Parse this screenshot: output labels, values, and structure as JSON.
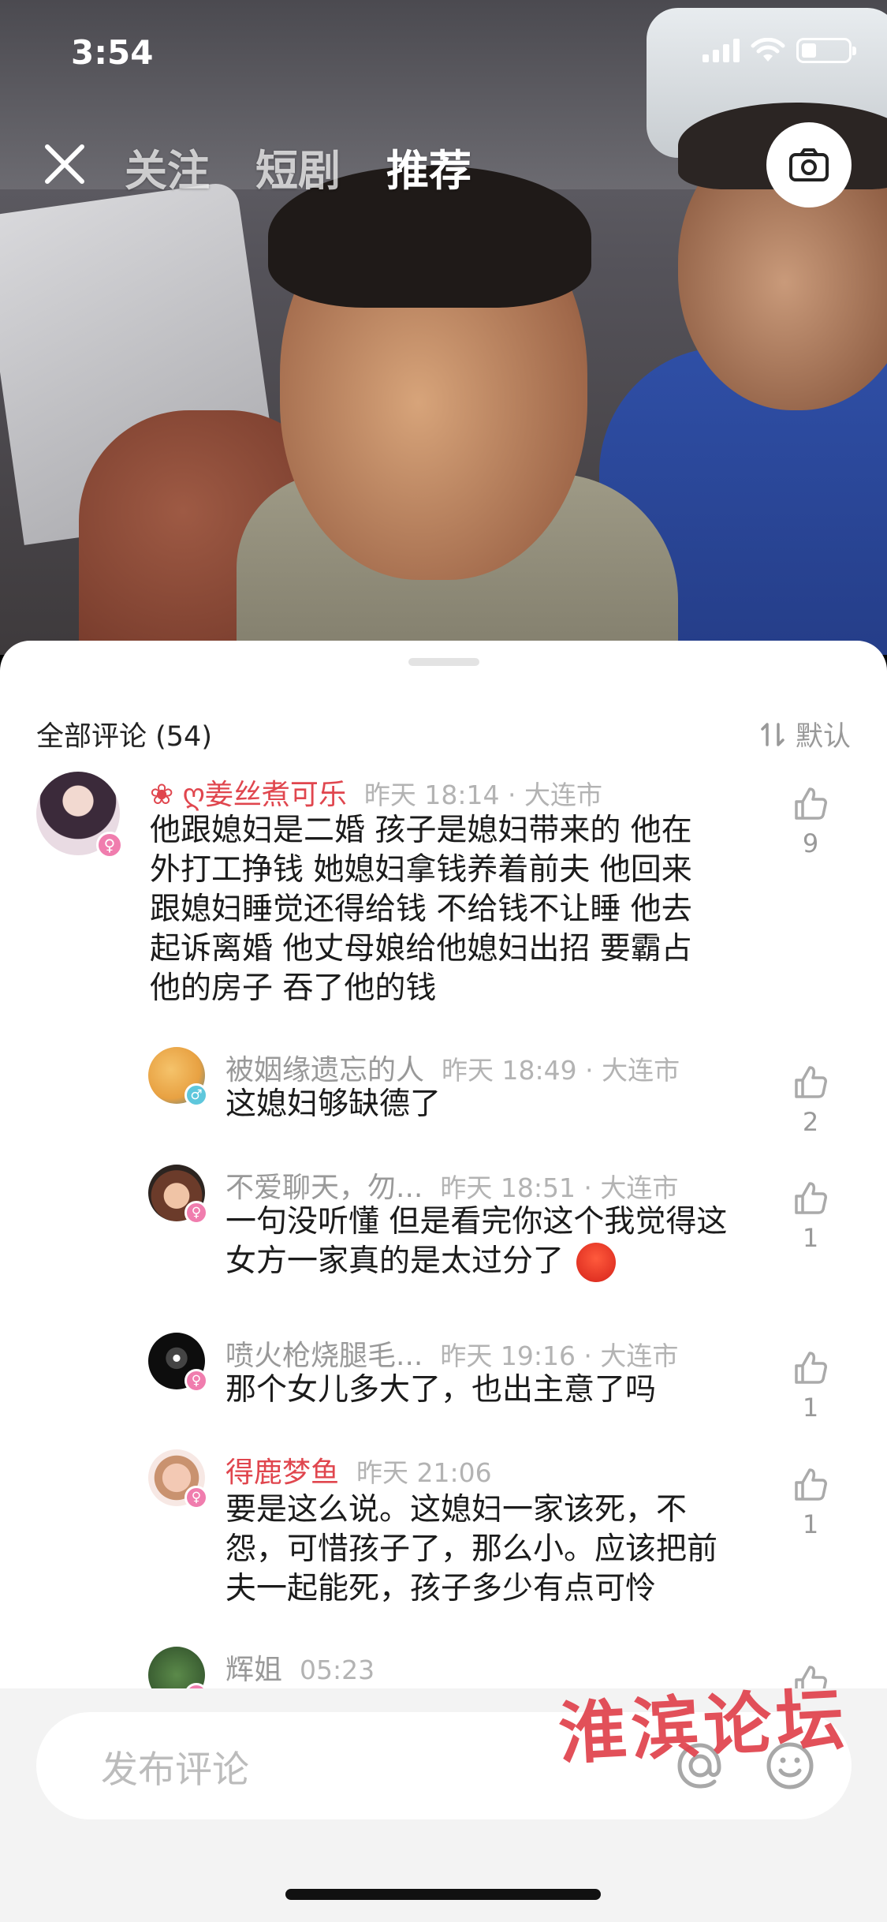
{
  "status": {
    "time": "3:54"
  },
  "nav": {
    "tabs": [
      "关注",
      "短剧",
      "推荐"
    ],
    "active_tab": "推荐"
  },
  "comments_sheet": {
    "title": "全部评论 (54)",
    "sort_label": "默认",
    "comments": [
      {
        "name": "❀ ღ姜丝煮可乐",
        "time": "昨天 18:14 · 大连市",
        "text": "他跟媳妇是二婚 孩子是媳妇带来的 他在外打工挣钱 她媳妇拿钱养着前夫 他回来跟媳妇睡觉还得给钱 不给钱不让睡 他去起诉离婚 他丈母娘给他媳妇出招 要霸占他的房子 吞了他的钱",
        "likes": "9",
        "gender": "♀"
      }
    ],
    "replies": [
      {
        "name": "被姻缘遗忘的人",
        "time": "昨天 18:49 · 大连市",
        "text": "这媳妇够缺德了",
        "likes": "2",
        "gender": "♂"
      },
      {
        "name": "不爱聊天，勿...",
        "time": "昨天 18:51 · 大连市",
        "text": "一句没听懂 但是看完你这个我觉得这女方一家真的是太过分了",
        "likes": "1",
        "gender": "♀"
      },
      {
        "name": "喷火枪烧腿毛...",
        "time": "昨天 19:16 · 大连市",
        "text": "那个女儿多大了，也出主意了吗",
        "likes": "1",
        "gender": "♀"
      },
      {
        "name": "得鹿梦鱼",
        "time": "昨天 21:06",
        "text": "要是这么说。这媳妇一家该死，不怨，可惜孩子了，那么小。应该把前夫一起能死，孩子多少有点可怜",
        "likes": "1",
        "gender": "♀"
      },
      {
        "name": "辉姐",
        "time": "05:23",
        "text": "",
        "likes": "",
        "gender": "♀"
      }
    ]
  },
  "input": {
    "placeholder": "发布评论"
  },
  "watermark": "淮滨论坛",
  "colors": {
    "accent_red": "#e0464e",
    "sheet_bg": "#ffffff",
    "bottom_bg": "#f3f3f3"
  }
}
